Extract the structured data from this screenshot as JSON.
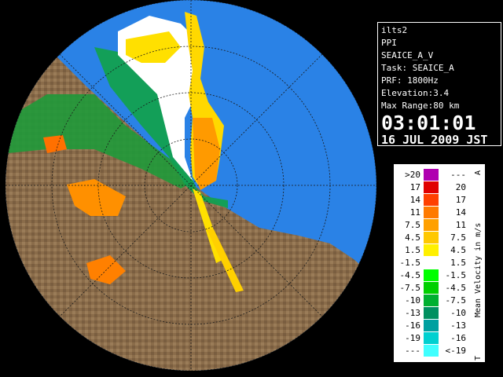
{
  "info": {
    "site": "ilts2",
    "product": "PPI",
    "field": "SEAICE_A_V",
    "task": "Task: SEAICE_A",
    "prf": "PRF: 1800Hz",
    "elevation": "Elevation:3.4",
    "max_range": "Max Range:80 km",
    "time": "03:01:01",
    "date": "16 JUL 2009 JST"
  },
  "legend": {
    "title": "Mean Velocity in m/s",
    "top_marker": "A",
    "bottom_marker": "T",
    "rows": [
      {
        "lo": ">20",
        "hi": "---",
        "color": "#b000b0"
      },
      {
        "lo": "17",
        "hi": "20",
        "color": "#e00000"
      },
      {
        "lo": "14",
        "hi": "17",
        "color": "#ff4000"
      },
      {
        "lo": "11",
        "hi": "14",
        "color": "#ff7a00"
      },
      {
        "lo": "7.5",
        "hi": "11",
        "color": "#ffa000"
      },
      {
        "lo": "4.5",
        "hi": "7.5",
        "color": "#ffc800"
      },
      {
        "lo": "1.5",
        "hi": "4.5",
        "color": "#fff000"
      },
      {
        "lo": "-1.5",
        "hi": "1.5",
        "color": "#ffffff"
      },
      {
        "lo": "-4.5",
        "hi": "-1.5",
        "color": "#00ff00"
      },
      {
        "lo": "-7.5",
        "hi": "-4.5",
        "color": "#00d000"
      },
      {
        "lo": "-10",
        "hi": "-7.5",
        "color": "#00b030"
      },
      {
        "lo": "-13",
        "hi": "-10",
        "color": "#009060"
      },
      {
        "lo": "-16",
        "hi": "-13",
        "color": "#00a0a0"
      },
      {
        "lo": "-19",
        "hi": "-16",
        "color": "#00d0d0"
      },
      {
        "lo": "---",
        "hi": "<-19",
        "color": "#40ffff"
      }
    ]
  },
  "colors": {
    "sea": "#2a82e6",
    "land": "#8a6c4a",
    "background": "#000000"
  }
}
